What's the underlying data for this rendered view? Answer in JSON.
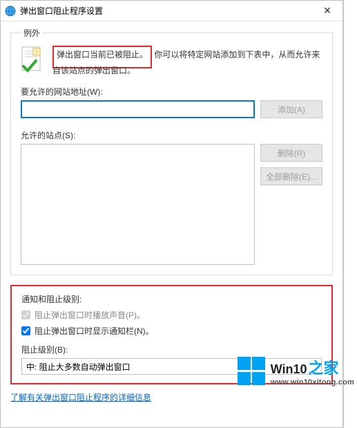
{
  "window": {
    "title": "弹出窗口阻止程序设置",
    "close_glyph": "✕"
  },
  "exceptions": {
    "legend": "例外",
    "intro_strong": "弹出窗口当前已被阻止。",
    "intro_rest": "你可以将特定网站添加到下表中，从而允许来自该站点的弹出窗口。",
    "address_label": "要允许的网站地址(W):",
    "address_value": "",
    "add_button": "添加(A)",
    "sites_label": "允许的站点(S):",
    "remove_button": "删除(R)",
    "remove_all_button": "全部删除(E)..."
  },
  "notify": {
    "heading": "通知和阻止级别:",
    "play_sound_checked": true,
    "play_sound_label": "阻止弹出窗口时播放声音(P)。",
    "show_bar_checked": true,
    "show_bar_label": "阻止弹出窗口时显示通知栏(N)。",
    "level_label": "阻止级别(B):",
    "level_value": "中: 阻止大多数自动弹出窗口"
  },
  "link": {
    "text": "了解有关弹出窗口阻止程序的详细信息"
  },
  "watermark": {
    "brand_prefix": "Win10",
    "brand_suffix": "之家",
    "url": "www.win10xitong.com"
  }
}
